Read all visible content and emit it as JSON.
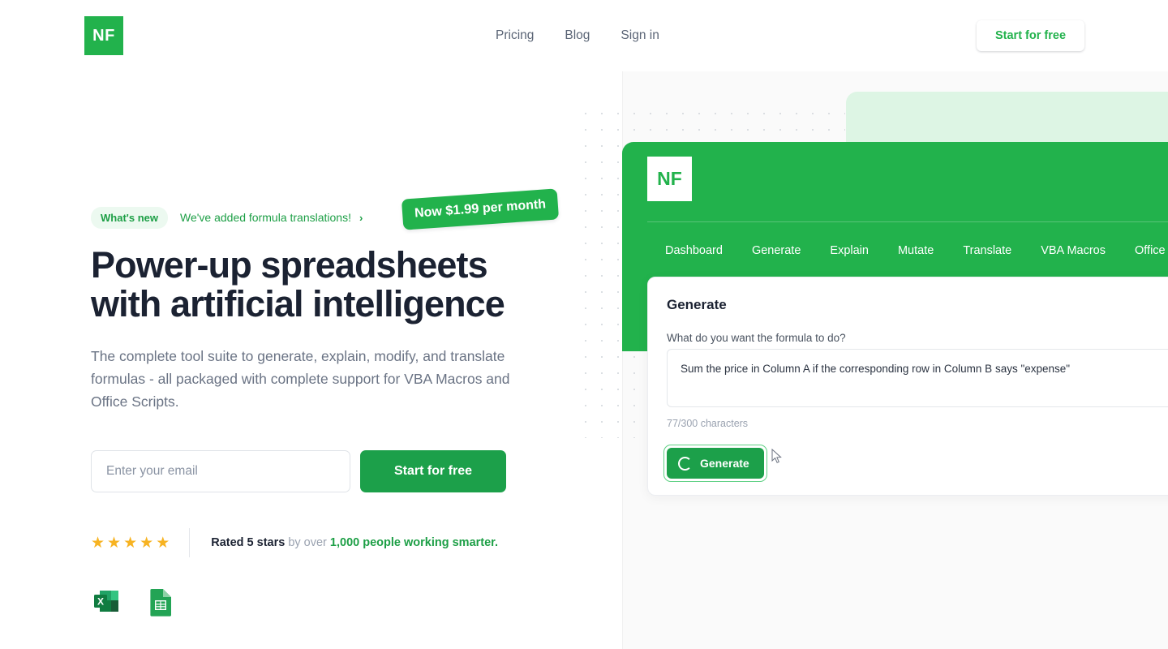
{
  "brand": {
    "logo_text": "NF",
    "accent_green": "#22b24c",
    "dark_green": "#1ca04a",
    "mint": "#ddf5e4",
    "heading_color": "#1b2232",
    "star_color": "#f7b322"
  },
  "header": {
    "nav": [
      {
        "label": "Pricing",
        "name": "nav-link-pricing"
      },
      {
        "label": "Blog",
        "name": "nav-link-blog"
      },
      {
        "label": "Sign in",
        "name": "nav-link-sign-in"
      }
    ],
    "cta_label": "Start for free"
  },
  "hero": {
    "badge_label": "What's new",
    "announce_text": "We've added formula translations!",
    "announce_chevron": "›",
    "price_badge_prefix": "Now ",
    "price_badge_amount": "$1.99",
    "price_badge_suffix": " per month",
    "headline": "Power-up spreadsheets with artificial intelligence",
    "subheadline": "The complete tool suite to generate, explain, modify, and translate formulas - all packaged with complete support for VBA Macros and Office Scripts.",
    "email_placeholder": "Enter your email",
    "email_value": "",
    "cta_label": "Start for free",
    "rating": {
      "stars": 5,
      "star_glyph": "★",
      "bold_text": "Rated 5 stars",
      "muted_text": " by over ",
      "green_text": "1,000 people working smarter."
    },
    "integrations": [
      {
        "name": "excel-icon",
        "label": "Microsoft Excel"
      },
      {
        "name": "google-sheets-icon",
        "label": "Google Sheets"
      }
    ]
  },
  "mockup": {
    "logo_text": "NF",
    "nav": [
      {
        "label": "Dashboard",
        "name": "mock-nav-dashboard"
      },
      {
        "label": "Generate",
        "name": "mock-nav-generate"
      },
      {
        "label": "Explain",
        "name": "mock-nav-explain"
      },
      {
        "label": "Mutate",
        "name": "mock-nav-mutate"
      },
      {
        "label": "Translate",
        "name": "mock-nav-translate"
      },
      {
        "label": "VBA Macros",
        "name": "mock-nav-vba-macros"
      },
      {
        "label": "Office Scripts",
        "name": "mock-nav-office-scripts"
      }
    ],
    "card": {
      "title": "Generate",
      "field_label": "What do you want the formula to do?",
      "textarea_value": "Sum the price in Column A if the corresponding row in Column B says \"expense\"",
      "char_count": "77/300 characters",
      "button_label": "Generate"
    }
  }
}
